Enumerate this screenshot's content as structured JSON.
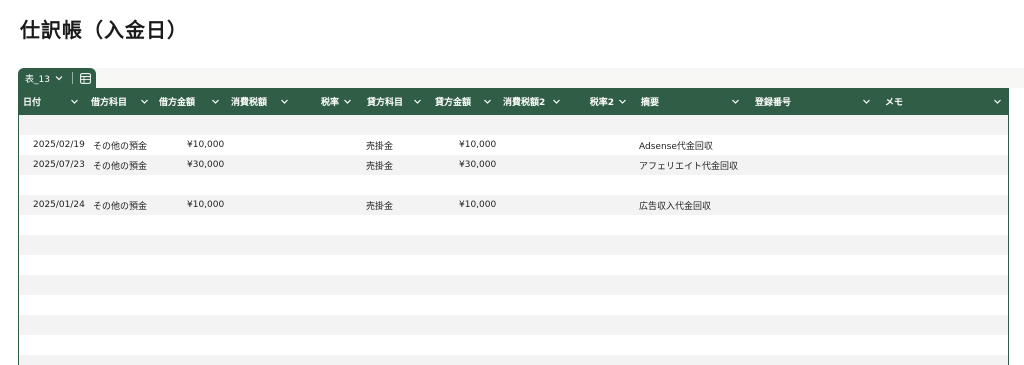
{
  "page": {
    "title": "仕訳帳（入金日）"
  },
  "tab": {
    "name": "表_13"
  },
  "columns": [
    {
      "label": "日付"
    },
    {
      "label": "借方科目"
    },
    {
      "label": "借方金額"
    },
    {
      "label": "消費税額"
    },
    {
      "label": "税率"
    },
    {
      "label": "貸方科目"
    },
    {
      "label": "貸方金額"
    },
    {
      "label": "消費税額2"
    },
    {
      "label": "税率2"
    },
    {
      "label": "摘要"
    },
    {
      "label": "登録番号"
    },
    {
      "label": "メモ"
    }
  ],
  "rows": [
    {
      "date": "",
      "debit_account": "",
      "debit_amount": "",
      "credit_account": "",
      "credit_amount": "",
      "description": ""
    },
    {
      "date": "2025/02/19",
      "debit_account": "その他の預金",
      "debit_amount": "¥10,000",
      "credit_account": "売掛金",
      "credit_amount": "¥10,000",
      "description": "Adsense代金回収"
    },
    {
      "date": "2025/07/23",
      "debit_account": "その他の預金",
      "debit_amount": "¥30,000",
      "credit_account": "売掛金",
      "credit_amount": "¥30,000",
      "description": "アフェリエイト代金回収"
    },
    {
      "date": "",
      "debit_account": "",
      "debit_amount": "",
      "credit_account": "",
      "credit_amount": "",
      "description": ""
    },
    {
      "date": "2025/01/24",
      "debit_account": "その他の預金",
      "debit_amount": "¥10,000",
      "credit_account": "売掛金",
      "credit_amount": "¥10,000",
      "description": "広告収入代金回収"
    },
    {
      "date": "",
      "debit_account": "",
      "debit_amount": "",
      "credit_account": "",
      "credit_amount": "",
      "description": ""
    },
    {
      "date": "",
      "debit_account": "",
      "debit_amount": "",
      "credit_account": "",
      "credit_amount": "",
      "description": ""
    },
    {
      "date": "",
      "debit_account": "",
      "debit_amount": "",
      "credit_account": "",
      "credit_amount": "",
      "description": ""
    },
    {
      "date": "",
      "debit_account": "",
      "debit_amount": "",
      "credit_account": "",
      "credit_amount": "",
      "description": ""
    },
    {
      "date": "",
      "debit_account": "",
      "debit_amount": "",
      "credit_account": "",
      "credit_amount": "",
      "description": ""
    },
    {
      "date": "",
      "debit_account": "",
      "debit_amount": "",
      "credit_account": "",
      "credit_amount": "",
      "description": ""
    },
    {
      "date": "",
      "debit_account": "",
      "debit_amount": "",
      "credit_account": "",
      "credit_amount": "",
      "description": ""
    },
    {
      "date": "",
      "debit_account": "",
      "debit_amount": "",
      "credit_account": "",
      "credit_amount": "",
      "description": ""
    }
  ],
  "icons": {
    "tab_menu": "chevron-down-icon",
    "table_view": "table-grid-icon",
    "column_menu": "chevron-down-icon"
  },
  "colors": {
    "header_bg": "#2f5d45",
    "row_alt": "#f3f3f3",
    "text": "#222222"
  }
}
